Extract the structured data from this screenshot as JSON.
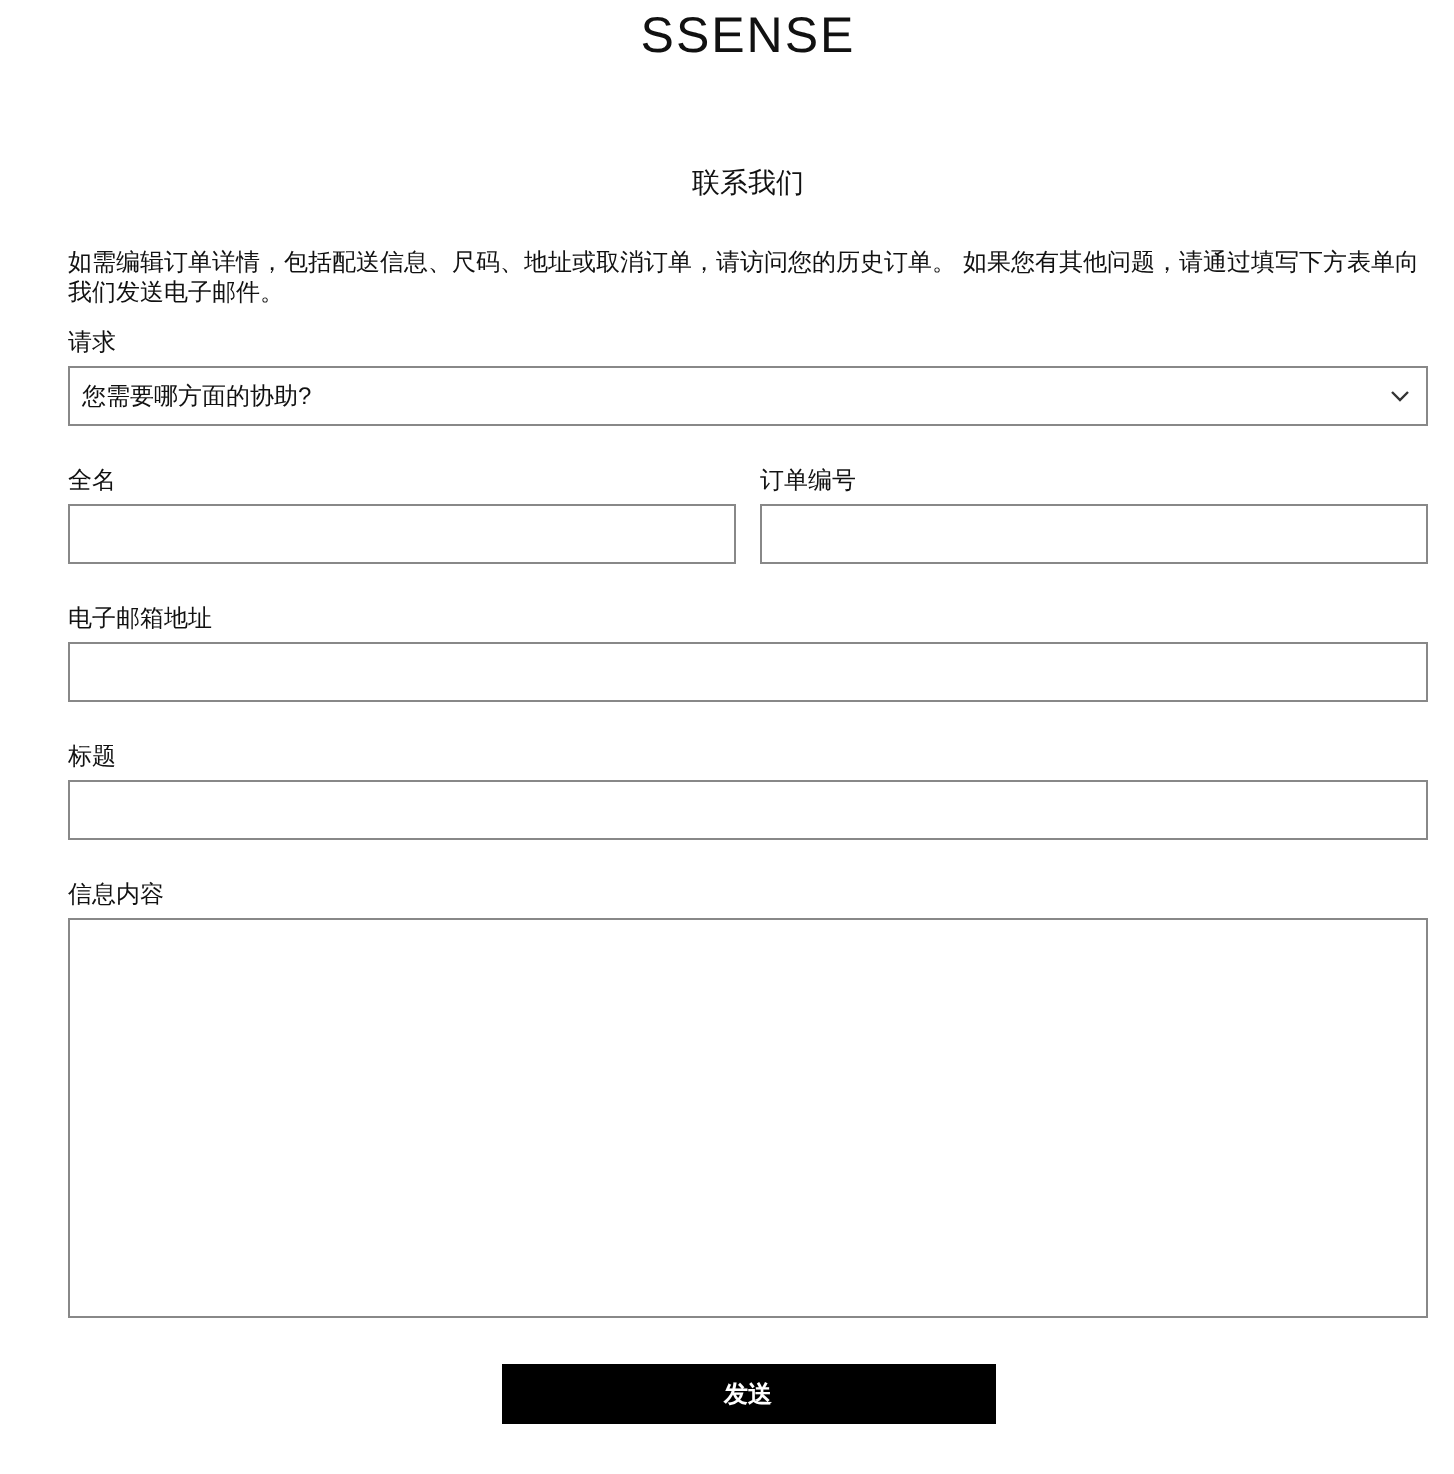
{
  "logo": "SSENSE",
  "title": "联系我们",
  "intro": "如需编辑订单详情，包括配送信息、尺码、地址或取消订单，请访问您的历史订单。 如果您有其他问题，请通过填写下方表单向我们发送电子邮件。",
  "request": {
    "label": "请求",
    "placeholder": "您需要哪方面的协助?"
  },
  "fields": [
    {
      "kind": "input",
      "label": "全名",
      "half": true
    },
    {
      "kind": "input",
      "label": "订单编号",
      "half": true
    },
    {
      "kind": "input",
      "label": "电子邮箱地址",
      "half": false
    },
    {
      "kind": "input",
      "label": "标题",
      "half": false
    },
    {
      "kind": "textarea",
      "label": "信息内容",
      "half": false
    }
  ],
  "submit": "发送"
}
